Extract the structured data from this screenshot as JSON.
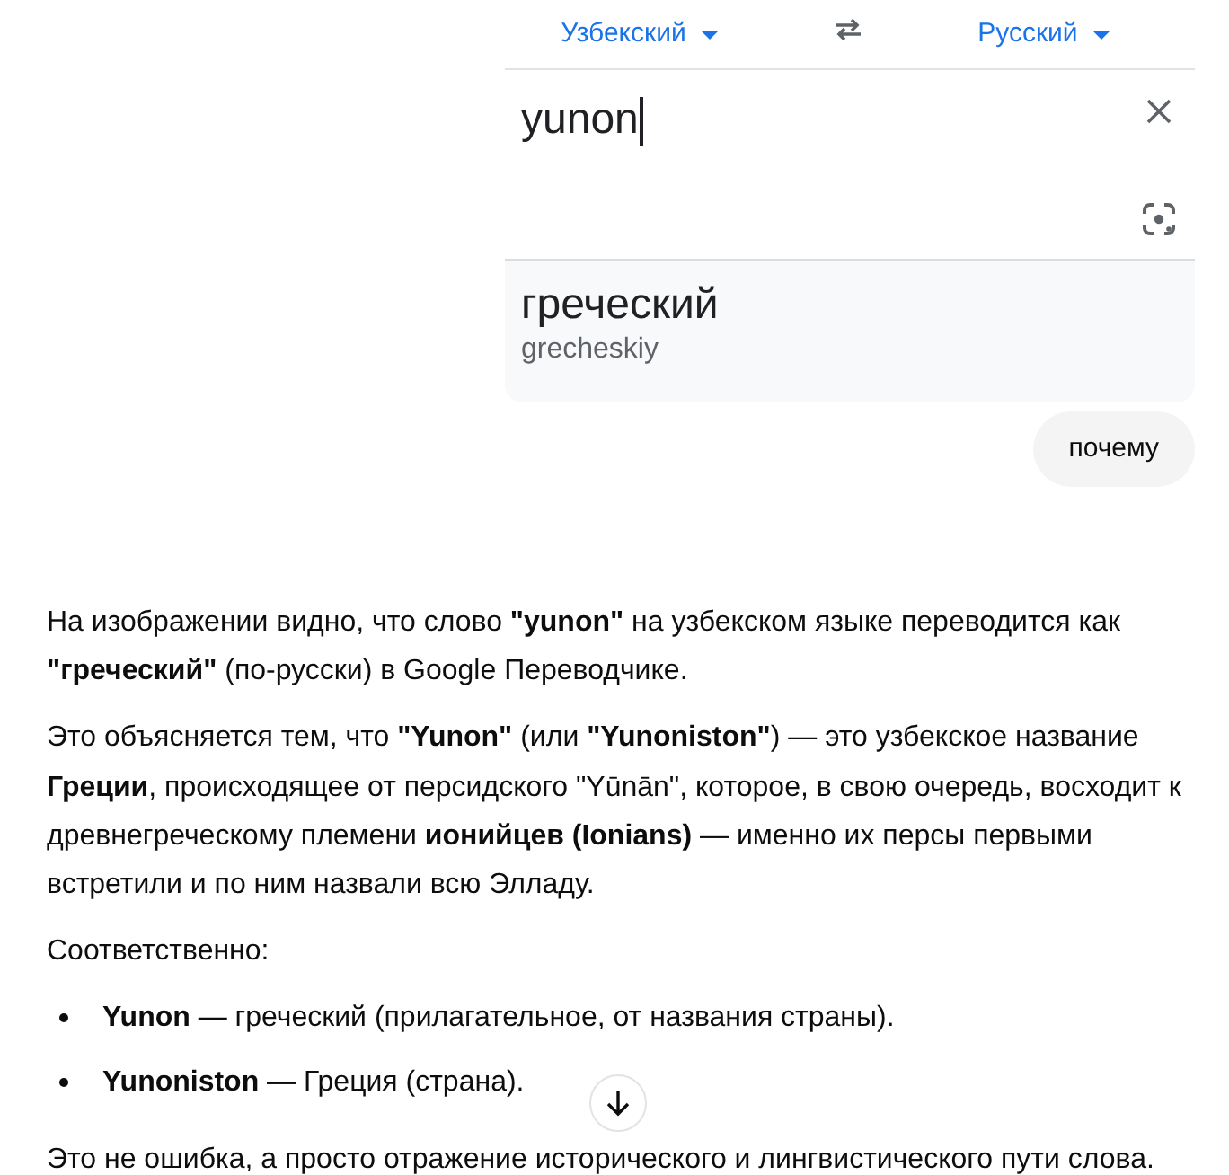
{
  "translate_screenshot": {
    "source_language": "Узбекский",
    "target_language": "Русский",
    "input_text": "yunon",
    "translation": "греческий",
    "transliteration": "grecheskiy"
  },
  "user_message": "почему",
  "assistant_message": [
    {
      "kind": "paragraph",
      "text": "На изображении видно, что слово **\"yunon\"** на узбекском языке переводится как **\"греческий\"** (по-русски) в Google Переводчике."
    },
    {
      "kind": "paragraph",
      "text": "Это объясняется тем, что **\"Yunon\"** (или **\"Yunoniston\"**) — это узбекское название **Греции**, происходящее от персидского \"Yūnān\", которое, в свою очередь, восходит к древнегреческому племени **ионийцев (Ionians)** — именно их персы первыми встретили и по ним назвали всю Элладу."
    },
    {
      "kind": "paragraph",
      "text": "Соответственно:"
    },
    {
      "kind": "list",
      "items": [
        "**Yunon** — греческий (прилагательное, от названия страны).",
        "**Yunoniston** — Греция (страна)."
      ]
    },
    {
      "kind": "paragraph",
      "text": "Это не ошибка, а просто отражение исторического и лингвистического пути слова."
    }
  ]
}
